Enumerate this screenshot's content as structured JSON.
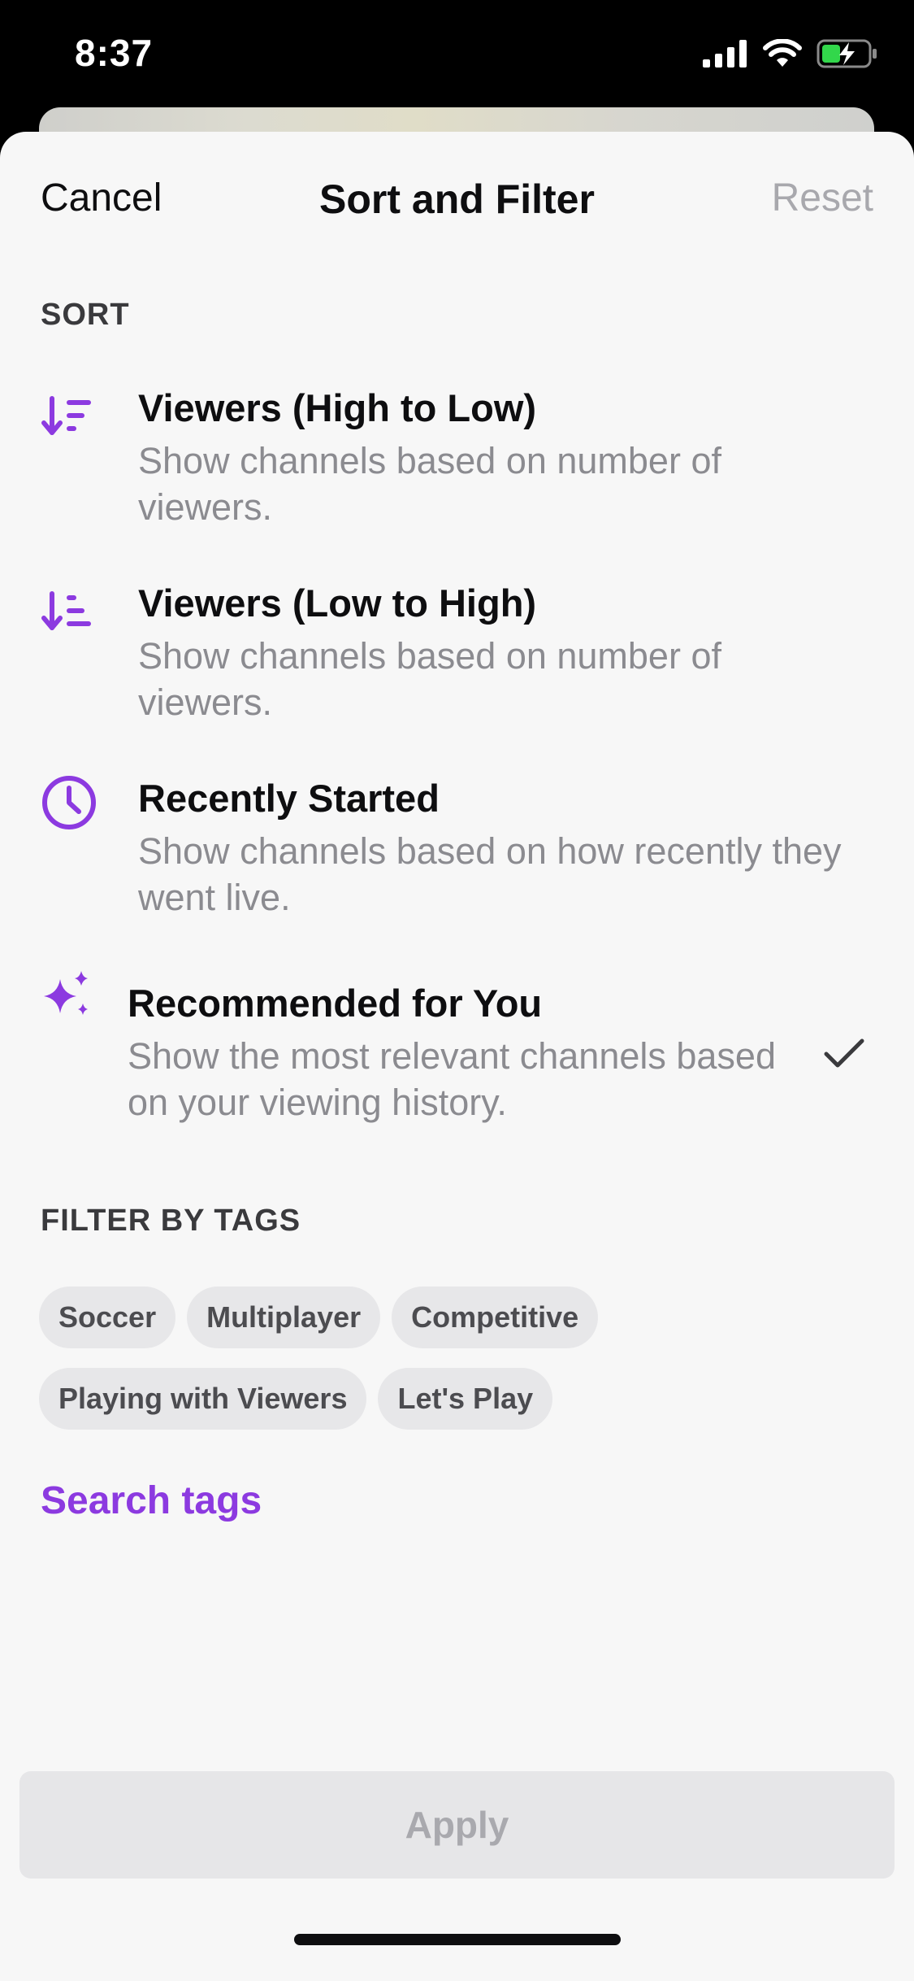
{
  "status_bar": {
    "time": "8:37"
  },
  "nav": {
    "cancel": "Cancel",
    "title": "Sort and Filter",
    "reset": "Reset"
  },
  "sort": {
    "heading": "SORT",
    "options": [
      {
        "icon": "sort-descending-icon",
        "title": "Viewers (High to Low)",
        "desc": "Show channels based on number of viewers.",
        "selected": false
      },
      {
        "icon": "sort-ascending-icon",
        "title": "Viewers (Low to High)",
        "desc": "Show channels based on number of viewers.",
        "selected": false
      },
      {
        "icon": "clock-icon",
        "title": "Recently Started",
        "desc": "Show channels based on how recently they went live.",
        "selected": false
      },
      {
        "icon": "sparkle-icon",
        "title": "Recommended for You",
        "desc": "Show the most relevant channels based on your viewing history.",
        "selected": true
      }
    ]
  },
  "filter": {
    "heading": "FILTER BY TAGS",
    "tags": [
      "Soccer",
      "Multiplayer",
      "Competitive",
      "Playing with Viewers",
      "Let's Play"
    ],
    "search_label": "Search tags"
  },
  "apply_label": "Apply",
  "colors": {
    "accent": "#8c3ae0",
    "sheet_bg": "#f7f7f7",
    "tag_bg": "#e7e7e9",
    "battery_green": "#32d74b"
  }
}
